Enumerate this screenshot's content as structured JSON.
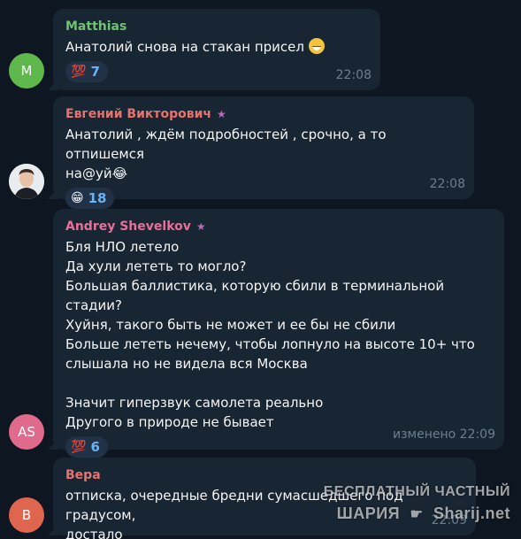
{
  "colors": {
    "background": "#0e1621",
    "bubble": "#182533",
    "timestamp": "#6d7f8f",
    "reaction_count": "#6ab3f3",
    "sender_matthias": "#6fc46f",
    "sender_evgeniy": "#e5736f",
    "sender_andrey": "#e86f9c",
    "sender_vera": "#e5736f",
    "star_icon": "#b76bb4"
  },
  "messages": [
    {
      "sender": "Matthias",
      "text": "Анатолий снова на стакан присел",
      "avatar_initials": "M",
      "avatar_color": "#5fb84c",
      "reaction": {
        "icon": "hundred-points-icon",
        "glyph": "💯",
        "count": "7"
      },
      "time": "22:08"
    },
    {
      "sender": "Евгений Викторович",
      "text": "Анатолий , ждём подробностей , срочно, а то отпишемся\nна@уй",
      "avatar_initials": "",
      "avatar_icon": "user-photo-avatar",
      "reaction": {
        "icon": "grinning-face-icon",
        "glyph": "😁",
        "count": "18"
      },
      "time": "22:08"
    },
    {
      "sender": "Andrey Shevelkov",
      "text": "Бля НЛО летело\nДа хули лететь то могло?\nБольшая баллистика, которую сбили в терминальной стадии?\nХуйня, такого быть не может и ее бы не сбили\nБольше лететь нечему, чтобы лопнуло на высоте 10+ что\nслышала но не видела вся Москва\n\nЗначит гиперзвук самолета реально\nДругого в природе не бывает",
      "avatar_initials": "AS",
      "avatar_color": "#e06a8c",
      "reaction": {
        "icon": "hundred-points-icon",
        "glyph": "💯",
        "count": "6"
      },
      "time": "изменено 22:09"
    },
    {
      "sender": "Вера",
      "text": "отписка, очередные бредни сумасшедшего под градусом,\nдостало",
      "avatar_initials": "B",
      "avatar_color": "#e0654e",
      "time": "22:09"
    }
  ],
  "watermark": {
    "line1": "БЕСПЛАТНЫЙ ЧАСТНЫЙ",
    "line2_left": "ШАРИЯ",
    "line2_right": "Sharij.net",
    "icon": "pointing-hand-icon"
  }
}
